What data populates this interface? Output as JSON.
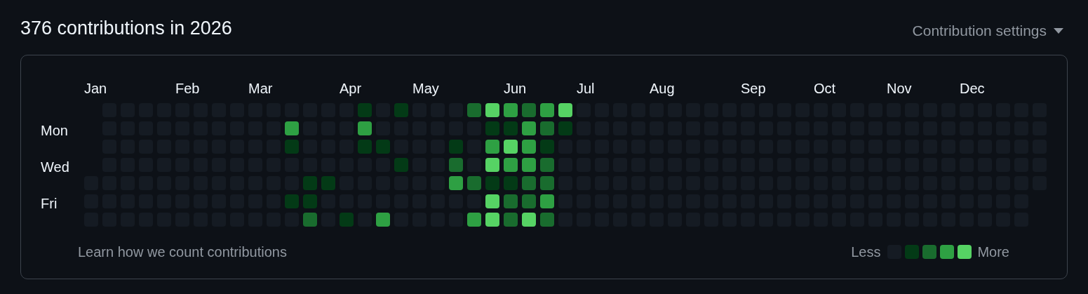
{
  "title": "376 contributions in 2026",
  "settings": {
    "label": "Contribution settings"
  },
  "day_labels": [
    {
      "label": "Mon"
    },
    {
      "label": "Wed"
    },
    {
      "label": "Fri"
    }
  ],
  "weeks": [
    {
      "month": "Jan",
      "days": [
        {
          "color": "#151b23"
        },
        {
          "color": "#151b23"
        },
        {
          "color": "#151b23"
        }
      ]
    },
    {
      "days": [
        {
          "color": "#151b23"
        },
        {
          "color": "#151b23"
        },
        {
          "color": "#151b23"
        },
        {
          "color": "#151b23"
        },
        {
          "color": "#151b23"
        },
        {
          "color": "#151b23"
        },
        {
          "color": "#151b23"
        }
      ]
    },
    {
      "days": [
        {
          "color": "#151b23"
        },
        {
          "color": "#151b23"
        },
        {
          "color": "#151b23"
        },
        {
          "color": "#151b23"
        },
        {
          "color": "#151b23"
        },
        {
          "color": "#151b23"
        },
        {
          "color": "#151b23"
        }
      ]
    },
    {
      "days": [
        {
          "color": "#151b23"
        },
        {
          "color": "#151b23"
        },
        {
          "color": "#151b23"
        },
        {
          "color": "#151b23"
        },
        {
          "color": "#151b23"
        },
        {
          "color": "#151b23"
        },
        {
          "color": "#151b23"
        }
      ]
    },
    {
      "days": [
        {
          "color": "#151b23"
        },
        {
          "color": "#151b23"
        },
        {
          "color": "#151b23"
        },
        {
          "color": "#151b23"
        },
        {
          "color": "#151b23"
        },
        {
          "color": "#151b23"
        },
        {
          "color": "#151b23"
        }
      ]
    },
    {
      "month": "Feb",
      "days": [
        {
          "color": "#151b23"
        },
        {
          "color": "#151b23"
        },
        {
          "color": "#151b23"
        },
        {
          "color": "#151b23"
        },
        {
          "color": "#151b23"
        },
        {
          "color": "#151b23"
        },
        {
          "color": "#151b23"
        }
      ]
    },
    {
      "days": [
        {
          "color": "#151b23"
        },
        {
          "color": "#151b23"
        },
        {
          "color": "#151b23"
        },
        {
          "color": "#151b23"
        },
        {
          "color": "#151b23"
        },
        {
          "color": "#151b23"
        },
        {
          "color": "#151b23"
        }
      ]
    },
    {
      "days": [
        {
          "color": "#151b23"
        },
        {
          "color": "#151b23"
        },
        {
          "color": "#151b23"
        },
        {
          "color": "#151b23"
        },
        {
          "color": "#151b23"
        },
        {
          "color": "#151b23"
        },
        {
          "color": "#151b23"
        }
      ]
    },
    {
      "days": [
        {
          "color": "#151b23"
        },
        {
          "color": "#151b23"
        },
        {
          "color": "#151b23"
        },
        {
          "color": "#151b23"
        },
        {
          "color": "#151b23"
        },
        {
          "color": "#151b23"
        },
        {
          "color": "#151b23"
        }
      ]
    },
    {
      "month": "Mar",
      "days": [
        {
          "color": "#151b23"
        },
        {
          "color": "#151b23"
        },
        {
          "color": "#151b23"
        },
        {
          "color": "#151b23"
        },
        {
          "color": "#151b23"
        },
        {
          "color": "#151b23"
        },
        {
          "color": "#151b23"
        }
      ]
    },
    {
      "days": [
        {
          "color": "#151b23"
        },
        {
          "color": "#151b23"
        },
        {
          "color": "#151b23"
        },
        {
          "color": "#151b23"
        },
        {
          "color": "#151b23"
        },
        {
          "color": "#151b23"
        },
        {
          "color": "#151b23"
        }
      ]
    },
    {
      "days": [
        {
          "color": "#151b23"
        },
        {
          "color": "#2ea043"
        },
        {
          "color": "#033a16"
        },
        {
          "color": "#151b23"
        },
        {
          "color": "#151b23"
        },
        {
          "color": "#033a16"
        },
        {
          "color": "#151b23"
        }
      ]
    },
    {
      "days": [
        {
          "color": "#151b23"
        },
        {
          "color": "#151b23"
        },
        {
          "color": "#151b23"
        },
        {
          "color": "#151b23"
        },
        {
          "color": "#033a16"
        },
        {
          "color": "#033a16"
        },
        {
          "color": "#196c2e"
        }
      ]
    },
    {
      "days": [
        {
          "color": "#151b23"
        },
        {
          "color": "#151b23"
        },
        {
          "color": "#151b23"
        },
        {
          "color": "#151b23"
        },
        {
          "color": "#033a16"
        },
        {
          "color": "#151b23"
        },
        {
          "color": "#151b23"
        }
      ]
    },
    {
      "month": "Apr",
      "days": [
        {
          "color": "#151b23"
        },
        {
          "color": "#151b23"
        },
        {
          "color": "#151b23"
        },
        {
          "color": "#151b23"
        },
        {
          "color": "#151b23"
        },
        {
          "color": "#151b23"
        },
        {
          "color": "#033a16"
        }
      ]
    },
    {
      "days": [
        {
          "color": "#033a16"
        },
        {
          "color": "#2ea043"
        },
        {
          "color": "#033a16"
        },
        {
          "color": "#151b23"
        },
        {
          "color": "#151b23"
        },
        {
          "color": "#151b23"
        },
        {
          "color": "#151b23"
        }
      ]
    },
    {
      "days": [
        {
          "color": "#151b23"
        },
        {
          "color": "#151b23"
        },
        {
          "color": "#033a16"
        },
        {
          "color": "#151b23"
        },
        {
          "color": "#151b23"
        },
        {
          "color": "#151b23"
        },
        {
          "color": "#2ea043"
        }
      ]
    },
    {
      "days": [
        {
          "color": "#033a16"
        },
        {
          "color": "#151b23"
        },
        {
          "color": "#151b23"
        },
        {
          "color": "#033a16"
        },
        {
          "color": "#151b23"
        },
        {
          "color": "#151b23"
        },
        {
          "color": "#151b23"
        }
      ]
    },
    {
      "month": "May",
      "days": [
        {
          "color": "#151b23"
        },
        {
          "color": "#151b23"
        },
        {
          "color": "#151b23"
        },
        {
          "color": "#151b23"
        },
        {
          "color": "#151b23"
        },
        {
          "color": "#151b23"
        },
        {
          "color": "#151b23"
        }
      ]
    },
    {
      "days": [
        {
          "color": "#151b23"
        },
        {
          "color": "#151b23"
        },
        {
          "color": "#151b23"
        },
        {
          "color": "#151b23"
        },
        {
          "color": "#151b23"
        },
        {
          "color": "#151b23"
        },
        {
          "color": "#151b23"
        }
      ]
    },
    {
      "days": [
        {
          "color": "#151b23"
        },
        {
          "color": "#151b23"
        },
        {
          "color": "#033a16"
        },
        {
          "color": "#196c2e"
        },
        {
          "color": "#2ea043"
        },
        {
          "color": "#151b23"
        },
        {
          "color": "#151b23"
        }
      ]
    },
    {
      "days": [
        {
          "color": "#196c2e"
        },
        {
          "color": "#151b23"
        },
        {
          "color": "#151b23"
        },
        {
          "color": "#151b23"
        },
        {
          "color": "#196c2e"
        },
        {
          "color": "#151b23"
        },
        {
          "color": "#2ea043"
        }
      ]
    },
    {
      "days": [
        {
          "color": "#56d364"
        },
        {
          "color": "#033a16"
        },
        {
          "color": "#2ea043"
        },
        {
          "color": "#56d364"
        },
        {
          "color": "#033a16"
        },
        {
          "color": "#56d364"
        },
        {
          "color": "#56d364"
        }
      ]
    },
    {
      "month": "Jun",
      "days": [
        {
          "color": "#2ea043"
        },
        {
          "color": "#033a16"
        },
        {
          "color": "#56d364"
        },
        {
          "color": "#2ea043"
        },
        {
          "color": "#033a16"
        },
        {
          "color": "#196c2e"
        },
        {
          "color": "#196c2e"
        }
      ]
    },
    {
      "days": [
        {
          "color": "#196c2e"
        },
        {
          "color": "#2ea043"
        },
        {
          "color": "#2ea043"
        },
        {
          "color": "#2ea043"
        },
        {
          "color": "#196c2e"
        },
        {
          "color": "#196c2e"
        },
        {
          "color": "#56d364"
        }
      ]
    },
    {
      "days": [
        {
          "color": "#2ea043"
        },
        {
          "color": "#196c2e"
        },
        {
          "color": "#033a16"
        },
        {
          "color": "#196c2e"
        },
        {
          "color": "#196c2e"
        },
        {
          "color": "#2ea043"
        },
        {
          "color": "#196c2e"
        }
      ]
    },
    {
      "days": [
        {
          "color": "#56d364"
        },
        {
          "color": "#033a16"
        },
        {
          "color": "#151b23"
        },
        {
          "color": "#151b23"
        },
        {
          "color": "#151b23"
        },
        {
          "color": "#151b23"
        },
        {
          "color": "#151b23"
        }
      ]
    },
    {
      "month": "Jul",
      "days": [
        {
          "color": "#151b23"
        },
        {
          "color": "#151b23"
        },
        {
          "color": "#151b23"
        },
        {
          "color": "#151b23"
        },
        {
          "color": "#151b23"
        },
        {
          "color": "#151b23"
        },
        {
          "color": "#151b23"
        }
      ]
    },
    {
      "days": [
        {
          "color": "#151b23"
        },
        {
          "color": "#151b23"
        },
        {
          "color": "#151b23"
        },
        {
          "color": "#151b23"
        },
        {
          "color": "#151b23"
        },
        {
          "color": "#151b23"
        },
        {
          "color": "#151b23"
        }
      ]
    },
    {
      "days": [
        {
          "color": "#151b23"
        },
        {
          "color": "#151b23"
        },
        {
          "color": "#151b23"
        },
        {
          "color": "#151b23"
        },
        {
          "color": "#151b23"
        },
        {
          "color": "#151b23"
        },
        {
          "color": "#151b23"
        }
      ]
    },
    {
      "days": [
        {
          "color": "#151b23"
        },
        {
          "color": "#151b23"
        },
        {
          "color": "#151b23"
        },
        {
          "color": "#151b23"
        },
        {
          "color": "#151b23"
        },
        {
          "color": "#151b23"
        },
        {
          "color": "#151b23"
        }
      ]
    },
    {
      "month": "Aug",
      "days": [
        {
          "color": "#151b23"
        },
        {
          "color": "#151b23"
        },
        {
          "color": "#151b23"
        },
        {
          "color": "#151b23"
        },
        {
          "color": "#151b23"
        },
        {
          "color": "#151b23"
        },
        {
          "color": "#151b23"
        }
      ]
    },
    {
      "days": [
        {
          "color": "#151b23"
        },
        {
          "color": "#151b23"
        },
        {
          "color": "#151b23"
        },
        {
          "color": "#151b23"
        },
        {
          "color": "#151b23"
        },
        {
          "color": "#151b23"
        },
        {
          "color": "#151b23"
        }
      ]
    },
    {
      "days": [
        {
          "color": "#151b23"
        },
        {
          "color": "#151b23"
        },
        {
          "color": "#151b23"
        },
        {
          "color": "#151b23"
        },
        {
          "color": "#151b23"
        },
        {
          "color": "#151b23"
        },
        {
          "color": "#151b23"
        }
      ]
    },
    {
      "days": [
        {
          "color": "#151b23"
        },
        {
          "color": "#151b23"
        },
        {
          "color": "#151b23"
        },
        {
          "color": "#151b23"
        },
        {
          "color": "#151b23"
        },
        {
          "color": "#151b23"
        },
        {
          "color": "#151b23"
        }
      ]
    },
    {
      "days": [
        {
          "color": "#151b23"
        },
        {
          "color": "#151b23"
        },
        {
          "color": "#151b23"
        },
        {
          "color": "#151b23"
        },
        {
          "color": "#151b23"
        },
        {
          "color": "#151b23"
        },
        {
          "color": "#151b23"
        }
      ]
    },
    {
      "month": "Sep",
      "days": [
        {
          "color": "#151b23"
        },
        {
          "color": "#151b23"
        },
        {
          "color": "#151b23"
        },
        {
          "color": "#151b23"
        },
        {
          "color": "#151b23"
        },
        {
          "color": "#151b23"
        },
        {
          "color": "#151b23"
        }
      ]
    },
    {
      "days": [
        {
          "color": "#151b23"
        },
        {
          "color": "#151b23"
        },
        {
          "color": "#151b23"
        },
        {
          "color": "#151b23"
        },
        {
          "color": "#151b23"
        },
        {
          "color": "#151b23"
        },
        {
          "color": "#151b23"
        }
      ]
    },
    {
      "days": [
        {
          "color": "#151b23"
        },
        {
          "color": "#151b23"
        },
        {
          "color": "#151b23"
        },
        {
          "color": "#151b23"
        },
        {
          "color": "#151b23"
        },
        {
          "color": "#151b23"
        },
        {
          "color": "#151b23"
        }
      ]
    },
    {
      "days": [
        {
          "color": "#151b23"
        },
        {
          "color": "#151b23"
        },
        {
          "color": "#151b23"
        },
        {
          "color": "#151b23"
        },
        {
          "color": "#151b23"
        },
        {
          "color": "#151b23"
        },
        {
          "color": "#151b23"
        }
      ]
    },
    {
      "month": "Oct",
      "days": [
        {
          "color": "#151b23"
        },
        {
          "color": "#151b23"
        },
        {
          "color": "#151b23"
        },
        {
          "color": "#151b23"
        },
        {
          "color": "#151b23"
        },
        {
          "color": "#151b23"
        },
        {
          "color": "#151b23"
        }
      ]
    },
    {
      "days": [
        {
          "color": "#151b23"
        },
        {
          "color": "#151b23"
        },
        {
          "color": "#151b23"
        },
        {
          "color": "#151b23"
        },
        {
          "color": "#151b23"
        },
        {
          "color": "#151b23"
        },
        {
          "color": "#151b23"
        }
      ]
    },
    {
      "days": [
        {
          "color": "#151b23"
        },
        {
          "color": "#151b23"
        },
        {
          "color": "#151b23"
        },
        {
          "color": "#151b23"
        },
        {
          "color": "#151b23"
        },
        {
          "color": "#151b23"
        },
        {
          "color": "#151b23"
        }
      ]
    },
    {
      "days": [
        {
          "color": "#151b23"
        },
        {
          "color": "#151b23"
        },
        {
          "color": "#151b23"
        },
        {
          "color": "#151b23"
        },
        {
          "color": "#151b23"
        },
        {
          "color": "#151b23"
        },
        {
          "color": "#151b23"
        }
      ]
    },
    {
      "month": "Nov",
      "days": [
        {
          "color": "#151b23"
        },
        {
          "color": "#151b23"
        },
        {
          "color": "#151b23"
        },
        {
          "color": "#151b23"
        },
        {
          "color": "#151b23"
        },
        {
          "color": "#151b23"
        },
        {
          "color": "#151b23"
        }
      ]
    },
    {
      "days": [
        {
          "color": "#151b23"
        },
        {
          "color": "#151b23"
        },
        {
          "color": "#151b23"
        },
        {
          "color": "#151b23"
        },
        {
          "color": "#151b23"
        },
        {
          "color": "#151b23"
        },
        {
          "color": "#151b23"
        }
      ]
    },
    {
      "days": [
        {
          "color": "#151b23"
        },
        {
          "color": "#151b23"
        },
        {
          "color": "#151b23"
        },
        {
          "color": "#151b23"
        },
        {
          "color": "#151b23"
        },
        {
          "color": "#151b23"
        },
        {
          "color": "#151b23"
        }
      ]
    },
    {
      "days": [
        {
          "color": "#151b23"
        },
        {
          "color": "#151b23"
        },
        {
          "color": "#151b23"
        },
        {
          "color": "#151b23"
        },
        {
          "color": "#151b23"
        },
        {
          "color": "#151b23"
        },
        {
          "color": "#151b23"
        }
      ]
    },
    {
      "month": "Dec",
      "days": [
        {
          "color": "#151b23"
        },
        {
          "color": "#151b23"
        },
        {
          "color": "#151b23"
        },
        {
          "color": "#151b23"
        },
        {
          "color": "#151b23"
        },
        {
          "color": "#151b23"
        },
        {
          "color": "#151b23"
        }
      ]
    },
    {
      "days": [
        {
          "color": "#151b23"
        },
        {
          "color": "#151b23"
        },
        {
          "color": "#151b23"
        },
        {
          "color": "#151b23"
        },
        {
          "color": "#151b23"
        },
        {
          "color": "#151b23"
        },
        {
          "color": "#151b23"
        }
      ]
    },
    {
      "days": [
        {
          "color": "#151b23"
        },
        {
          "color": "#151b23"
        },
        {
          "color": "#151b23"
        },
        {
          "color": "#151b23"
        },
        {
          "color": "#151b23"
        },
        {
          "color": "#151b23"
        },
        {
          "color": "#151b23"
        }
      ]
    },
    {
      "days": [
        {
          "color": "#151b23"
        },
        {
          "color": "#151b23"
        },
        {
          "color": "#151b23"
        },
        {
          "color": "#151b23"
        },
        {
          "color": "#151b23"
        },
        {
          "color": "#151b23"
        },
        {
          "color": "#151b23"
        }
      ]
    },
    {
      "days": [
        {
          "color": "#151b23"
        },
        {
          "color": "#151b23"
        },
        {
          "color": "#151b23"
        },
        {
          "color": "#151b23"
        },
        {
          "color": "#151b23"
        }
      ]
    }
  ],
  "footer": {
    "link": "Learn how we count contributions"
  },
  "legend": {
    "less": "Less",
    "more": "More",
    "colors": [
      {
        "color": "#151b23"
      },
      {
        "color": "#033a16"
      },
      {
        "color": "#196c2e"
      },
      {
        "color": "#2ea043"
      },
      {
        "color": "#56d364"
      }
    ]
  }
}
